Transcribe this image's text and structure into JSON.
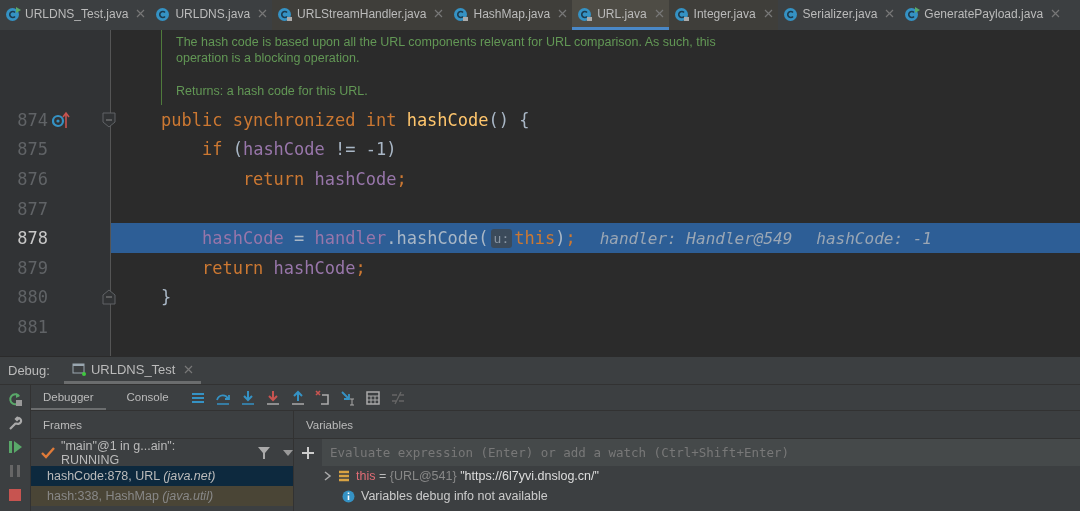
{
  "tabs": [
    {
      "label": "URLDNS_Test.java",
      "kind": "runnable",
      "selected": false
    },
    {
      "label": "URLDNS.java",
      "kind": "class",
      "selected": false
    },
    {
      "label": "URLStreamHandler.java",
      "kind": "locked",
      "selected": false
    },
    {
      "label": "HashMap.java",
      "kind": "locked",
      "selected": false
    },
    {
      "label": "URL.java",
      "kind": "locked",
      "selected": true
    },
    {
      "label": "Integer.java",
      "kind": "locked",
      "selected": false
    },
    {
      "label": "Serializer.java",
      "kind": "class",
      "selected": false
    },
    {
      "label": "GeneratePayload.java",
      "kind": "runnable",
      "selected": false
    }
  ],
  "editor": {
    "doc": [
      {
        "lines": [
          "The hash code is based upon all the URL components relevant for URL comparison. As such, this",
          "operation is a blocking operation."
        ]
      },
      {
        "lines": [
          "Returns: a hash code for this URL."
        ]
      }
    ],
    "lines": [
      {
        "number": "874",
        "current": false,
        "kind": "override-start",
        "tokens": [
          {
            "kind": "keyword",
            "text": "public synchronized int "
          },
          {
            "kind": "method",
            "text": "hashCode"
          },
          {
            "kind": "plain",
            "text": "() {"
          }
        ]
      },
      {
        "number": "875",
        "current": false,
        "kind": "code",
        "tokens": [
          {
            "kind": "keyword",
            "text": "    if "
          },
          {
            "kind": "plain",
            "text": "("
          },
          {
            "kind": "field",
            "text": "hashCode"
          },
          {
            "kind": "plain",
            "text": " != -1)"
          }
        ]
      },
      {
        "number": "876",
        "current": false,
        "kind": "code",
        "tokens": [
          {
            "kind": "keyword",
            "text": "        return "
          },
          {
            "kind": "field",
            "text": "hashCode"
          },
          {
            "kind": "keyword",
            "text": ";"
          }
        ]
      },
      {
        "number": "877",
        "current": false,
        "kind": "code"
      },
      {
        "number": "878",
        "current": true,
        "kind": "code",
        "tokens": [
          {
            "kind": "field",
            "text": "    hashCode"
          },
          {
            "kind": "plain",
            "text": " = "
          },
          {
            "kind": "field",
            "text": "handler"
          },
          {
            "kind": "plain",
            "text": ".hashCode("
          },
          {
            "kind": "hint",
            "text": "u:"
          },
          {
            "kind": "keyword",
            "text": "this"
          },
          {
            "kind": "plain",
            "text": ")"
          },
          {
            "kind": "keyword",
            "text": ";"
          },
          {
            "kind": "value",
            "text": "handler: Handler@549"
          },
          {
            "kind": "value",
            "text": "hashCode: -1"
          }
        ]
      },
      {
        "number": "879",
        "current": false,
        "kind": "code",
        "tokens": [
          {
            "kind": "keyword",
            "text": "    return "
          },
          {
            "kind": "field",
            "text": "hashCode"
          },
          {
            "kind": "keyword",
            "text": ";"
          }
        ]
      },
      {
        "number": "880",
        "current": false,
        "kind": "block-end",
        "tokens": [
          {
            "kind": "plain",
            "text": "}"
          }
        ]
      },
      {
        "number": "881",
        "current": false,
        "kind": "code"
      }
    ]
  },
  "debug": {
    "label": "Debug:",
    "session": "URLDNS_Test",
    "tabs": [
      {
        "label": "Debugger",
        "selected": true
      },
      {
        "label": "Console",
        "selected": false
      }
    ],
    "frames_title": "Frames",
    "thread": "\"main\"@1 in g...ain\": RUNNING",
    "frames": [
      {
        "text": "hashCode:878, URL *(java.net)*",
        "selected": true,
        "library": false
      },
      {
        "text": "hash:338, HashMap *(java.util)*",
        "selected": false,
        "library": true
      }
    ],
    "variables_title": "Variables",
    "evaluate_placeholder": "Evaluate expression (Enter) or add a watch (Ctrl+Shift+Enter)",
    "variables": [
      {
        "name": "this",
        "operator": "=",
        "type": "{URL@541}",
        "value": "\"https://6l7yvi.dnslog.cn/\""
      }
    ],
    "info": "Variables debug info not available"
  }
}
